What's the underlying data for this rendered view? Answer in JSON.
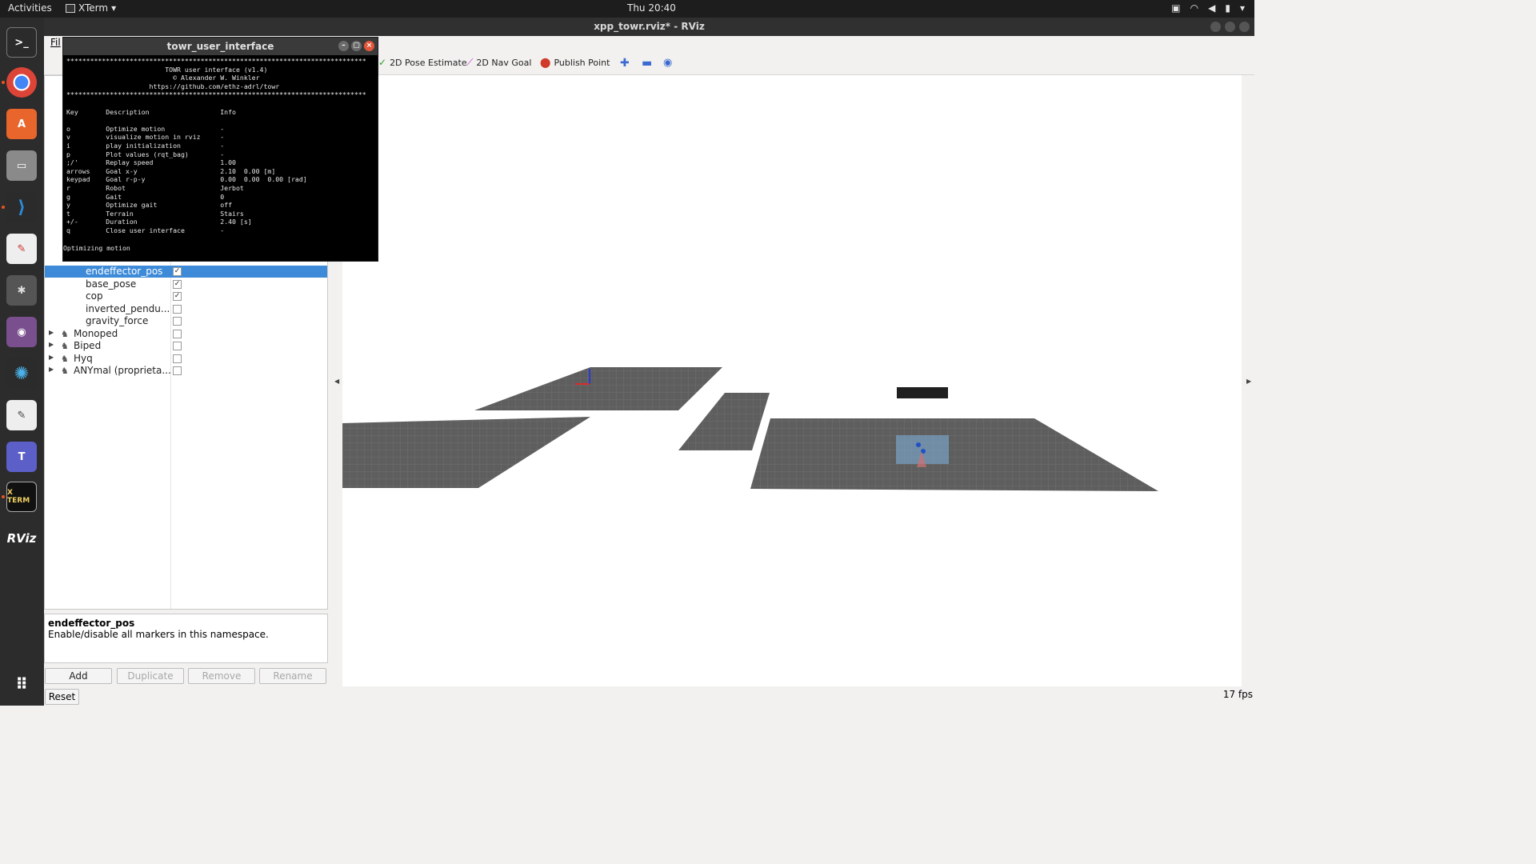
{
  "topbar": {
    "activities": "Activities",
    "app_name": "XTerm",
    "clock": "Thu 20:40"
  },
  "dock": {
    "items": [
      {
        "name": "terminal-icon"
      },
      {
        "name": "chrome-icon"
      },
      {
        "name": "software-center-icon"
      },
      {
        "name": "file-manager-icon"
      },
      {
        "name": "vscode-icon"
      },
      {
        "name": "document-viewer-icon"
      },
      {
        "name": "system-tools-icon"
      },
      {
        "name": "media-icon"
      },
      {
        "name": "settings-gear-icon"
      },
      {
        "name": "text-editor-icon"
      },
      {
        "name": "teams-icon"
      },
      {
        "name": "xterm-icon",
        "label": "X TERM"
      },
      {
        "name": "rviz-icon",
        "label": "RViz"
      },
      {
        "name": "app-grid-icon"
      }
    ]
  },
  "rviz": {
    "window_title": "xpp_towr.rviz* - RViz",
    "menu_file": "Fil",
    "toolbar": {
      "pose_estimate": "2D Pose Estimate",
      "nav_goal": "2D Nav Goal",
      "publish_point": "Publish Point"
    },
    "tree": [
      {
        "label": "endeffector_pos",
        "checked": true,
        "selected": true,
        "indent": 2
      },
      {
        "label": "base_pose",
        "checked": true,
        "selected": false,
        "indent": 2
      },
      {
        "label": "cop",
        "checked": true,
        "selected": false,
        "indent": 2
      },
      {
        "label": "inverted_pendu...",
        "checked": false,
        "selected": false,
        "indent": 2
      },
      {
        "label": "gravity_force",
        "checked": false,
        "selected": false,
        "indent": 2
      },
      {
        "label": "Monoped",
        "checked": false,
        "selected": false,
        "indent": 1
      },
      {
        "label": "Biped",
        "checked": false,
        "selected": false,
        "indent": 1
      },
      {
        "label": "Hyq",
        "checked": false,
        "selected": false,
        "indent": 1
      },
      {
        "label": "ANYmal (proprieta...",
        "checked": false,
        "selected": false,
        "indent": 1
      }
    ],
    "description": {
      "title": "endeffector_pos",
      "text": "Enable/disable all markers in this namespace."
    },
    "buttons": {
      "add": "Add",
      "duplicate": "Duplicate",
      "remove": "Remove",
      "rename": "Rename",
      "reset": "Reset"
    },
    "fps": "17 fps"
  },
  "xterm": {
    "title": "towr_user_interface",
    "header_rule": "****************************************************************************",
    "header_lines": [
      "TOWR user interface (v1.4)",
      "© Alexander W. Winkler",
      "https://github.com/ethz-adrl/towr"
    ],
    "columns": {
      "key": "Key",
      "desc": "Description",
      "info": "Info"
    },
    "rows": [
      {
        "key": "o",
        "desc": "Optimize motion",
        "info": "-"
      },
      {
        "key": "v",
        "desc": "visualize motion in rviz",
        "info": "-"
      },
      {
        "key": "i",
        "desc": "play initialization",
        "info": "-"
      },
      {
        "key": "p",
        "desc": "Plot values (rqt_bag)",
        "info": "-"
      },
      {
        "key": ";/'",
        "desc": "Replay speed",
        "info": "1.00"
      },
      {
        "key": "arrows",
        "desc": "Goal x-y",
        "info": "2.10  0.00 [m]"
      },
      {
        "key": "keypad",
        "desc": "Goal r-p-y",
        "info": "0.00  0.00  0.00 [rad]"
      },
      {
        "key": "r",
        "desc": "Robot",
        "info": "Jerbot"
      },
      {
        "key": "g",
        "desc": "Gait",
        "info": "0"
      },
      {
        "key": "y",
        "desc": "Optimize gait",
        "info": "off"
      },
      {
        "key": "t",
        "desc": "Terrain",
        "info": "Stairs"
      },
      {
        "key": "+/-",
        "desc": "Duration",
        "info": "2.40 [s]"
      },
      {
        "key": "q",
        "desc": "Close user interface",
        "info": "-"
      }
    ],
    "status": "Optimizing motion"
  }
}
